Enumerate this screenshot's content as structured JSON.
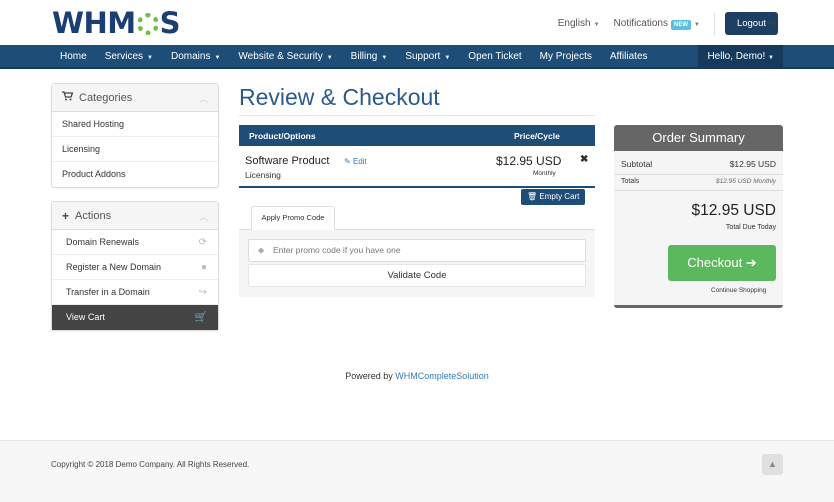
{
  "brand": {
    "logo_pre": "WHM",
    "logo_post": "S",
    "accent": "#1e4d78",
    "logo_green": "#6fbe44"
  },
  "topnav": {
    "language": "English",
    "notifications": "Notifications",
    "new_badge": "NEW",
    "logout": "Logout"
  },
  "mainnav": {
    "items": [
      {
        "label": "Home",
        "dropdown": false
      },
      {
        "label": "Services",
        "dropdown": true
      },
      {
        "label": "Domains",
        "dropdown": true
      },
      {
        "label": "Website & Security",
        "dropdown": true
      },
      {
        "label": "Billing",
        "dropdown": true
      },
      {
        "label": "Support",
        "dropdown": true
      },
      {
        "label": "Open Ticket",
        "dropdown": false
      },
      {
        "label": "My Projects",
        "dropdown": false
      },
      {
        "label": "Affiliates",
        "dropdown": false
      }
    ],
    "user": "Hello, Demo!"
  },
  "sidebar": {
    "categories": {
      "title": "Categories",
      "items": [
        "Shared Hosting",
        "Licensing",
        "Product Addons"
      ]
    },
    "actions": {
      "title": "Actions",
      "items": [
        {
          "label": "Domain Renewals",
          "icon": "refresh-icon"
        },
        {
          "label": "Register a New Domain",
          "icon": "globe-icon"
        },
        {
          "label": "Transfer in a Domain",
          "icon": "share-icon"
        },
        {
          "label": "View Cart",
          "icon": "cart-icon",
          "active": true
        }
      ]
    }
  },
  "main": {
    "title": "Review & Checkout",
    "cart": {
      "col_product": "Product/Options",
      "col_price": "Price/Cycle",
      "item": {
        "name": "Software Product",
        "edit": "Edit",
        "group": "Licensing",
        "price": "$12.95 USD",
        "cycle": "Monthly"
      },
      "empty_cart": "Empty Cart"
    },
    "promo": {
      "tab": "Apply Promo Code",
      "placeholder": "Enter promo code if you have one",
      "validate": "Validate Code"
    }
  },
  "summary": {
    "title": "Order Summary",
    "subtotal_label": "Subtotal",
    "subtotal_value": "$12.95 USD",
    "totals_label": "Totals",
    "totals_value": "$12.95 USD Monthly",
    "total_due": "$12.95 USD",
    "total_due_label": "Total Due Today",
    "checkout": "Checkout",
    "continue": "Continue Shopping"
  },
  "footer": {
    "powered_prefix": "Powered by ",
    "powered_link": "WHMCompleteSolution",
    "copyright": "Copyright © 2018 Demo Company. All Rights Reserved."
  }
}
